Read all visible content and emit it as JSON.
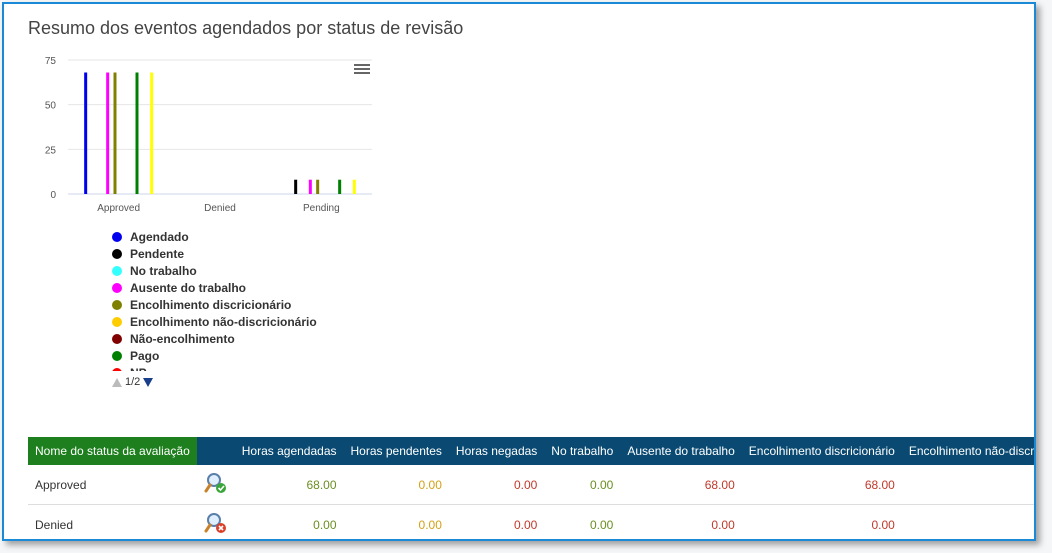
{
  "title": "Resumo dos eventos agendados por status de revisão",
  "chart_data": {
    "type": "bar",
    "categories": [
      "Approved",
      "Denied",
      "Pending"
    ],
    "yticks": [
      "0",
      "25",
      "50",
      "75"
    ],
    "ylim": [
      0,
      75
    ],
    "grid": true,
    "series": [
      {
        "name": "Agendado",
        "color": "#0000ee",
        "values": [
          68,
          0,
          0
        ]
      },
      {
        "name": "Pendente",
        "color": "#000000",
        "values": [
          0,
          0,
          8
        ]
      },
      {
        "name": "No trabalho",
        "color": "#33ffff",
        "values": [
          0,
          0,
          0
        ]
      },
      {
        "name": "Ausente do trabalho",
        "color": "#ff00ff",
        "values": [
          68,
          0,
          8
        ]
      },
      {
        "name": "Encolhimento discricionário",
        "color": "#808000",
        "values": [
          68,
          0,
          8
        ]
      },
      {
        "name": "Encolhimento não-discricionário",
        "color": "#ffcc00",
        "values": [
          0,
          0,
          0
        ]
      },
      {
        "name": "Não-encolhimento",
        "color": "#800000",
        "values": [
          0,
          0,
          0
        ]
      },
      {
        "name": "Pago",
        "color": "#008000",
        "values": [
          68,
          0,
          8
        ]
      },
      {
        "name": "NP",
        "color": "#ff0000",
        "values": [
          0,
          0,
          0
        ]
      },
      {
        "name": "",
        "color": "#ffff00",
        "values": [
          68,
          0,
          8
        ]
      }
    ]
  },
  "legend": {
    "items": [
      {
        "label": "Agendado",
        "color": "#0000ee"
      },
      {
        "label": "Pendente",
        "color": "#000000"
      },
      {
        "label": "No trabalho",
        "color": "#33ffff"
      },
      {
        "label": "Ausente do trabalho",
        "color": "#ff00ff"
      },
      {
        "label": "Encolhimento discricionário",
        "color": "#808000"
      },
      {
        "label": "Encolhimento não-discricionário",
        "color": "#ffcc00"
      },
      {
        "label": "Não-encolhimento",
        "color": "#800000"
      },
      {
        "label": "Pago",
        "color": "#008000"
      },
      {
        "label": "NP",
        "color": "#ff0000"
      }
    ],
    "pager": "1/2"
  },
  "table": {
    "headers": [
      "Nome do status da avaliação",
      "",
      "Horas agendadas",
      "Horas pendentes",
      "Horas negadas",
      "No trabalho",
      "Ausente do trabalho",
      "Encolhimento discricionário",
      "Encolhimento não-discricionário"
    ],
    "rows": [
      {
        "name": "Approved",
        "icon": "approved-search-icon",
        "values": [
          "68.00",
          "0.00",
          "0.00",
          "0.00",
          "68.00",
          "68.00",
          ""
        ]
      },
      {
        "name": "Denied",
        "icon": "denied-search-icon",
        "values": [
          "0.00",
          "0.00",
          "0.00",
          "0.00",
          "0.00",
          "0.00",
          ""
        ]
      }
    ],
    "value_colors": [
      "c-green",
      "c-orange",
      "c-red",
      "c-green",
      "c-red",
      "c-red",
      "c-red"
    ]
  }
}
